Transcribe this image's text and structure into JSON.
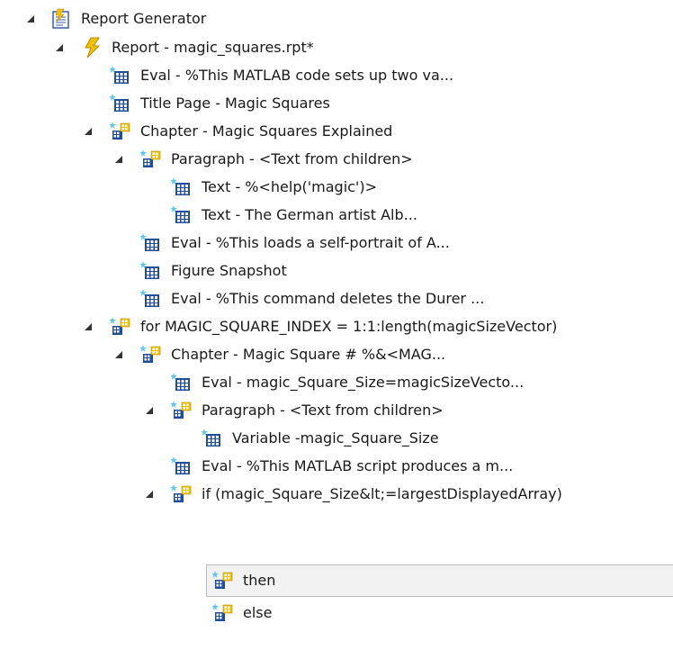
{
  "tree": {
    "nodes": [
      {
        "label": "Report Generator",
        "icon": "report-generator-icon",
        "expanded": true
      },
      {
        "label": "Report - magic_squares.rpt*",
        "icon": "report-lightning-icon",
        "expanded": true
      },
      {
        "label": "Eval - %This MATLAB code sets up two va...",
        "icon": "component-icon",
        "expanded": null
      },
      {
        "label": "Title Page - Magic Squares",
        "icon": "component-icon",
        "expanded": null
      },
      {
        "label": "Chapter - Magic Squares Explained",
        "icon": "parent-component-icon",
        "expanded": true
      },
      {
        "label": "Paragraph - <Text from children>",
        "icon": "parent-component-icon",
        "expanded": true
      },
      {
        "label": "Text - %<help('magic')>",
        "icon": "component-icon",
        "expanded": null
      },
      {
        "label": "Text - The German artist Alb...",
        "icon": "component-icon",
        "expanded": null
      },
      {
        "label": "Eval - %This loads a self-portrait of A...",
        "icon": "component-icon",
        "expanded": null
      },
      {
        "label": "Figure Snapshot",
        "icon": "component-icon",
        "expanded": null
      },
      {
        "label": "Eval - %This command deletes the Durer ...",
        "icon": "component-icon",
        "expanded": null
      },
      {
        "label": "for MAGIC_SQUARE_INDEX = 1:1:length(magicSizeVector)",
        "icon": "parent-component-icon",
        "expanded": true
      },
      {
        "label": "Chapter - Magic Square # %&<MAG...",
        "icon": "parent-component-icon",
        "expanded": true
      },
      {
        "label": "Eval - magic_Square_Size=magicSizeVecto...",
        "icon": "component-icon",
        "expanded": null
      },
      {
        "label": "Paragraph - <Text from children>",
        "icon": "parent-component-icon",
        "expanded": true
      },
      {
        "label": "Variable -magic_Square_Size",
        "icon": "component-icon",
        "expanded": null
      },
      {
        "label": "Eval - %This MATLAB script produces a m...",
        "icon": "component-icon",
        "expanded": null
      },
      {
        "label": "if (magic_Square_Size&lt;=largestDisplayedArray)",
        "icon": "parent-component-icon",
        "expanded": true
      },
      {
        "label": "then",
        "icon": "parent-component-icon",
        "expanded": null,
        "selected": true
      },
      {
        "label": "else",
        "icon": "parent-component-icon",
        "expanded": null
      }
    ]
  },
  "colors": {
    "selection_bg": "#f2f2f2",
    "selection_border": "#bdbdbd",
    "expander": "#333333",
    "icon_blue": "#1f4e9c",
    "icon_yellow": "#f2c200",
    "icon_cyan": "#5bc8f5"
  }
}
